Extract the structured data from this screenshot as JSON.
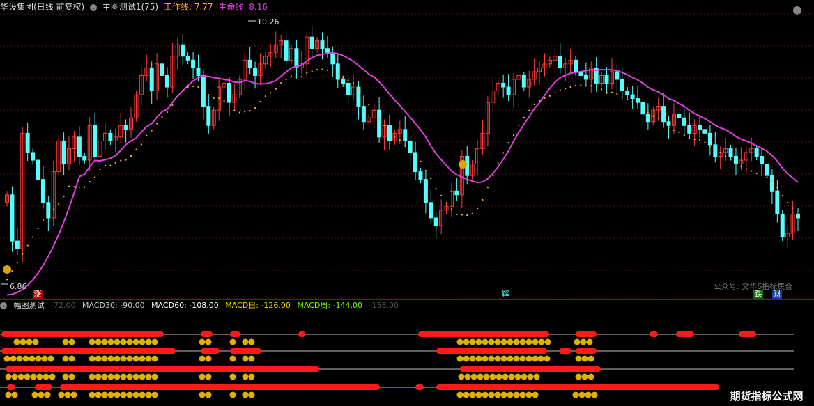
{
  "header": {
    "stock_title": "华设集团(日线 前复权)",
    "indicator_title": "主图测试1(75)",
    "work_line_label": "工作线:",
    "work_line_value": "7.77",
    "life_line_label": "生命线:",
    "life_line_value": "8.16"
  },
  "price_labels": {
    "high": "10.26",
    "low": "6.86"
  },
  "signals": {
    "zhang": "涨",
    "jie": "解",
    "die": "跌",
    "cai": "财"
  },
  "watermark": "公众号: 文华6指标集合",
  "sub_header": {
    "title": "幅图测试",
    "macd_prefix": "-72.00",
    "macd30": "MACD30: -90.00",
    "macd60": "MACD60: -108.00",
    "macd_day": "MACD日: -126.00",
    "macd_week": "MACD周: -144.00",
    "macd_suffix": "-158.00"
  },
  "logo_text": "期货指标公式网",
  "colors": {
    "up": "#ff3b3b",
    "down": "#54ffff",
    "life_line": "#e040e0",
    "work_line": "#ffb030",
    "grid": "#5a0c0c",
    "macd_day": "#ffd700",
    "macd_week": "#7cfc00"
  },
  "chart_data": {
    "type": "candlestick",
    "ylim": [
      6.7,
      10.4
    ],
    "marked_high": 10.26,
    "marked_low": 6.86,
    "work_line_last": 7.77,
    "life_line_last": 8.16
  }
}
